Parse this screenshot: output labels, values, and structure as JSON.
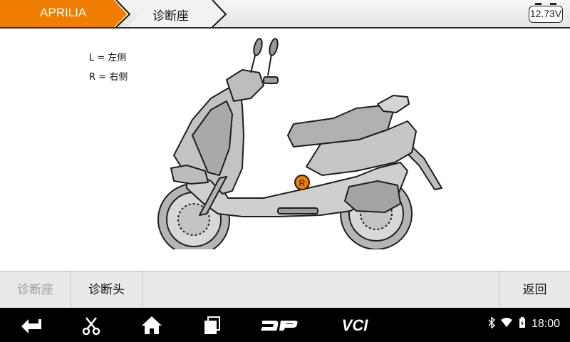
{
  "header": {
    "brand_tab": "APRILIA",
    "page_tab": "诊断座",
    "battery_voltage": "12.73V"
  },
  "diagram": {
    "legend_left": "L = 左侧",
    "legend_right": "R = 右侧",
    "marker_label": "R",
    "marker_color": "#f07d00"
  },
  "actions": {
    "seat_label": "诊断座",
    "head_label": "诊断头",
    "back_label": "返回"
  },
  "nav": {
    "icons": [
      "back-arrow-icon",
      "scissors-icon",
      "home-icon",
      "recent-apps-icon",
      "dp-logo-icon",
      "vci-logo-icon"
    ],
    "vci_text": "VCI",
    "time": "18:00"
  },
  "colors": {
    "accent": "#f07d00",
    "bar_bg": "#e9e9e9",
    "nav_bg": "#000000"
  }
}
